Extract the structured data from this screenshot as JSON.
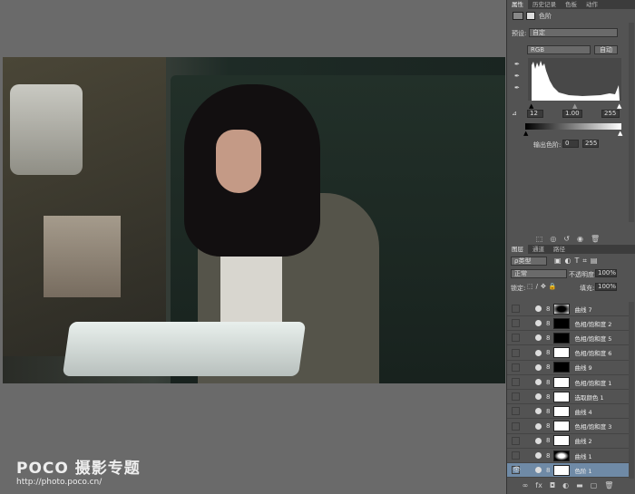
{
  "watermark": {
    "logo": "POCO 摄影专题",
    "url": "http://photo.poco.cn/"
  },
  "properties": {
    "tabs": [
      "属性",
      "历史记录",
      "色板",
      "动作"
    ],
    "title": "色阶",
    "preset_label": "预设:",
    "preset_value": "自定",
    "channel": "RGB",
    "auto_button": "自动",
    "input_black": "12",
    "input_gamma": "1.00",
    "input_white": "255",
    "output_label": "输出色阶:",
    "output_black": "0",
    "output_white": "255"
  },
  "layers": {
    "tabs": [
      "图层",
      "通道",
      "路径"
    ],
    "filter_kind": "ρ类型",
    "blend_mode": "正常",
    "opacity_label": "不透明度:",
    "opacity": "100%",
    "lock_label": "锁定:",
    "fill_label": "填充:",
    "fill": "100%",
    "items": [
      {
        "name": "曲线 7",
        "visible": false
      },
      {
        "name": "色相/饱和度 2",
        "visible": false
      },
      {
        "name": "色相/饱和度 5",
        "visible": false
      },
      {
        "name": "色相/饱和度 6",
        "visible": false
      },
      {
        "name": "曲线 9",
        "visible": false
      },
      {
        "name": "色相/饱和度 1",
        "visible": false
      },
      {
        "name": "选取颜色 1",
        "visible": false
      },
      {
        "name": "曲线 4",
        "visible": false
      },
      {
        "name": "色相/饱和度 3",
        "visible": false
      },
      {
        "name": "曲线 2",
        "visible": false
      },
      {
        "name": "曲线 1",
        "visible": false
      },
      {
        "name": "色阶 1",
        "visible": true,
        "selected": true
      }
    ]
  }
}
